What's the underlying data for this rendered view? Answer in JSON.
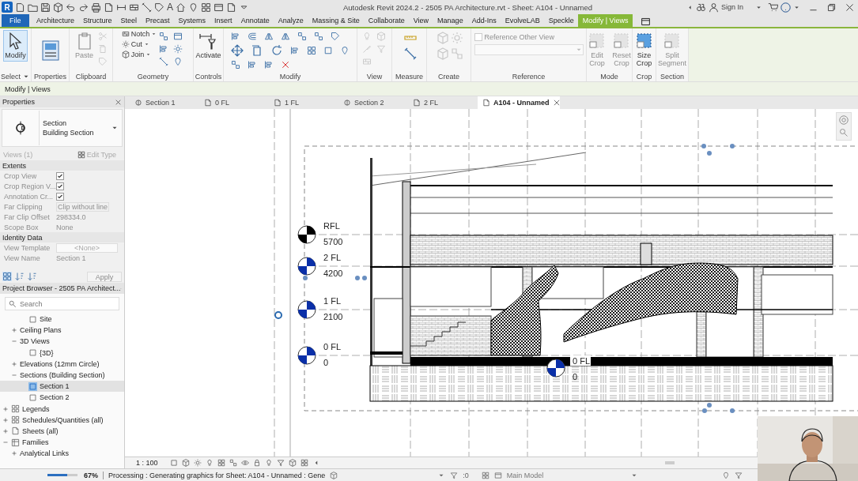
{
  "title_bar": {
    "logo": "R",
    "text_tool": "A",
    "title": "Autodesk Revit 2024.2 - 2505 PA Architecture.rvt - Sheet: A104 - Unnamed",
    "sign_in": "Sign In"
  },
  "ribbon_tabs": [
    {
      "label": "File",
      "kind": "file",
      "selected": false
    },
    {
      "label": "Architecture",
      "kind": "tab",
      "selected": false
    },
    {
      "label": "Structure",
      "kind": "tab",
      "selected": false
    },
    {
      "label": "Steel",
      "kind": "tab",
      "selected": false
    },
    {
      "label": "Precast",
      "kind": "tab",
      "selected": false
    },
    {
      "label": "Systems",
      "kind": "tab",
      "selected": false
    },
    {
      "label": "Insert",
      "kind": "tab",
      "selected": false
    },
    {
      "label": "Annotate",
      "kind": "tab",
      "selected": false
    },
    {
      "label": "Analyze",
      "kind": "tab",
      "selected": false
    },
    {
      "label": "Massing & Site",
      "kind": "tab",
      "selected": false
    },
    {
      "label": "Collaborate",
      "kind": "tab",
      "selected": false
    },
    {
      "label": "View",
      "kind": "tab",
      "selected": false
    },
    {
      "label": "Manage",
      "kind": "tab",
      "selected": false
    },
    {
      "label": "Add-Ins",
      "kind": "tab",
      "selected": false
    },
    {
      "label": "EvolveLAB",
      "kind": "tab",
      "selected": false
    },
    {
      "label": "Speckle",
      "kind": "tab",
      "selected": false
    },
    {
      "label": "Modify | Views",
      "kind": "contextual",
      "selected": true
    }
  ],
  "ribbon_panels": [
    {
      "label": "Select",
      "buttons": [
        {
          "label": "Modify",
          "kind": "large",
          "selected": true,
          "disabled": false
        }
      ]
    },
    {
      "label": "Properties"
    },
    {
      "label": "Clipboard",
      "buttons": [
        {
          "label": "Paste",
          "kind": "large",
          "selected": false,
          "disabled": true
        }
      ]
    },
    {
      "label": "Geometry",
      "buttons": [
        {
          "label": "Notch",
          "kind": "small"
        },
        {
          "label": "Cut",
          "kind": "small"
        },
        {
          "label": "Join",
          "kind": "small"
        }
      ]
    },
    {
      "label": "Controls",
      "buttons": [
        {
          "label": "Activate",
          "kind": "large",
          "selected": false,
          "disabled": false
        }
      ]
    },
    {
      "label": "Modify"
    },
    {
      "label": "View"
    },
    {
      "label": "Measure"
    },
    {
      "label": "Create"
    },
    {
      "label": "Reference",
      "buttons": [
        {
          "label": "Reference Other View",
          "kind": "checkbox",
          "checked": false,
          "disabled": true
        }
      ]
    },
    {
      "label": "Mode",
      "buttons": [
        {
          "label": "Edit Crop",
          "kind": "large",
          "selected": false,
          "disabled": true
        },
        {
          "label": "Reset Crop",
          "kind": "large",
          "selected": false,
          "disabled": true
        }
      ]
    },
    {
      "label": "Crop",
      "buttons": [
        {
          "label": "Size Crop",
          "kind": "large",
          "selected": false,
          "disabled": false
        }
      ]
    },
    {
      "label": "Section",
      "buttons": [
        {
          "label": "Split Segment",
          "kind": "large",
          "selected": false,
          "disabled": true
        }
      ]
    }
  ],
  "context_bar": {
    "label": "Modify | Views"
  },
  "properties": {
    "title": "Properties",
    "type_family": "Section",
    "type_name": "Building Section",
    "instance_filter": "Views (1)",
    "edit_type": "Edit Type",
    "apply": "Apply",
    "groups": [
      {
        "label": "Extents",
        "rows": [
          {
            "label": "Crop View",
            "kind": "checkbox",
            "checked": true
          },
          {
            "label": "Crop Region V...",
            "kind": "checkbox",
            "checked": true
          },
          {
            "label": "Annotation Cr...",
            "kind": "checkbox",
            "checked": true
          },
          {
            "label": "Far Clipping",
            "kind": "select",
            "value": "Clip without line"
          },
          {
            "label": "Far Clip Offset",
            "kind": "text",
            "value": "298334.0"
          },
          {
            "label": "Scope Box",
            "kind": "text",
            "value": "None"
          }
        ]
      },
      {
        "label": "Identity Data",
        "rows": [
          {
            "label": "View Template",
            "kind": "button",
            "value": "<None>"
          },
          {
            "label": "View Name",
            "kind": "text",
            "value": "Section 1"
          }
        ]
      }
    ]
  },
  "project_browser": {
    "title": "Project Browser - 2505 PA Architect...",
    "search": {
      "placeholder": "Search"
    },
    "tree": [
      {
        "children": [
          {
            "children": [
              {
                "label": "Site",
                "kind": "view",
                "selected": false
              }
            ]
          },
          {
            "label": "Ceiling Plans",
            "kind": "folder",
            "expanded": false,
            "selected": false
          },
          {
            "label": "3D Views",
            "kind": "folder",
            "expanded": true,
            "selected": false,
            "children": [
              {
                "label": "{3D}",
                "kind": "view",
                "selected": false
              }
            ]
          },
          {
            "label": "Elevations (12mm Circle)",
            "kind": "folder",
            "expanded": false,
            "selected": false
          },
          {
            "label": "Sections (Building Section)",
            "kind": "folder",
            "expanded": true,
            "selected": false,
            "children": [
              {
                "label": "Section 1",
                "kind": "view",
                "selected": true
              },
              {
                "label": "Section 2",
                "kind": "view",
                "selected": false
              }
            ]
          }
        ]
      },
      {
        "label": "Legends",
        "kind": "legend",
        "expanded": false,
        "selected": false
      },
      {
        "label": "Schedules/Quantities (all)",
        "kind": "schedule",
        "expanded": false,
        "selected": false
      },
      {
        "label": "Sheets (all)",
        "kind": "sheet",
        "expanded": false,
        "selected": false
      },
      {
        "label": "Families",
        "kind": "family",
        "expanded": true,
        "selected": false,
        "children": [
          {
            "label": "Analytical Links",
            "kind": "folder",
            "expanded": false,
            "selected": false
          }
        ]
      }
    ]
  },
  "view_tabs": [
    {
      "label": "Section 1",
      "kind": "section",
      "selected": false
    },
    {
      "label": "0 FL",
      "kind": "plan",
      "selected": false
    },
    {
      "label": "1 FL",
      "kind": "plan",
      "selected": false
    },
    {
      "label": "Section 2",
      "kind": "section",
      "selected": false
    },
    {
      "label": "2 FL",
      "kind": "plan",
      "selected": false
    },
    {
      "label": "A104 - Unnamed",
      "kind": "sheet",
      "selected": true
    }
  ],
  "canvas": {
    "levels": [
      {
        "name": "RFL",
        "elevation": "5700",
        "color": "#000000"
      },
      {
        "name": "2 FL",
        "elevation": "4200",
        "color": "#0a2fa8"
      },
      {
        "name": "1 FL",
        "elevation": "2100",
        "color": "#0a2fa8"
      },
      {
        "name": "0 FL",
        "elevation": "0",
        "color": "#0a2fa8"
      }
    ],
    "section_level": {
      "name": "0 FL",
      "elevation": "0",
      "color": "#0a2fa8"
    }
  },
  "view_control_bar": {
    "scale": "1 : 100"
  },
  "status_bar": {
    "progress": {
      "level": 0.67,
      "label": "67%"
    },
    "message": "Processing : Generating graphics for Sheet: A104 - Unnamed : Gene",
    "selection_count": ":0",
    "workset": "Main Model"
  }
}
